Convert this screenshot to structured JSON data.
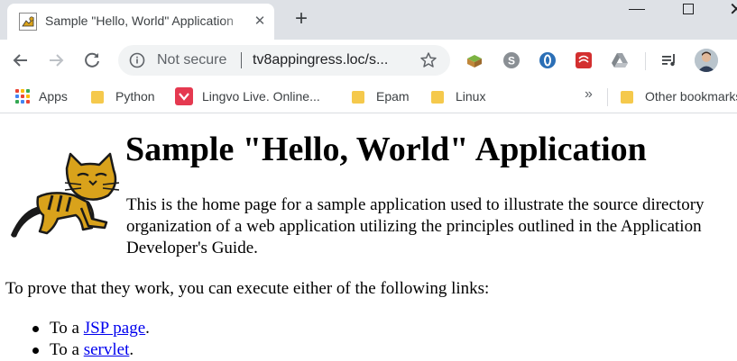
{
  "browser": {
    "tab": {
      "title": "Sample \"Hello, World\" Application",
      "close_label": "✕"
    },
    "new_tab_label": "+",
    "address_bar": {
      "security_label": "Not secure",
      "url": "tv8appingress.loc/s..."
    },
    "bookmarks": [
      {
        "label": "Apps",
        "icon": "apps-grid-icon"
      },
      {
        "label": "Python",
        "icon": "folder-icon"
      },
      {
        "label": "Lingvo Live. Online...",
        "icon": "lingvo-icon"
      },
      {
        "label": "Epam",
        "icon": "folder-icon"
      },
      {
        "label": "Linux",
        "icon": "folder-icon"
      }
    ],
    "bookmarks_overflow_label": "»",
    "other_bookmarks_label": "Other bookmarks",
    "colors": {
      "tabstrip": "#dee1e6",
      "omnibox": "#f1f3f4",
      "folder": "#f5c94c",
      "link": "#0000ee"
    }
  },
  "page": {
    "title": "Sample \"Hello, World\" Application",
    "intro": "This is the home page for a sample application used to illustrate the source directory organization of a web application utilizing the principles outlined in the Application Developer's Guide.",
    "prove_text": "To prove that they work, you can execute either of the following links:",
    "links": [
      {
        "prefix": "To a ",
        "link_text": "JSP page",
        "suffix": "."
      },
      {
        "prefix": "To a ",
        "link_text": "servlet",
        "suffix": "."
      }
    ]
  }
}
